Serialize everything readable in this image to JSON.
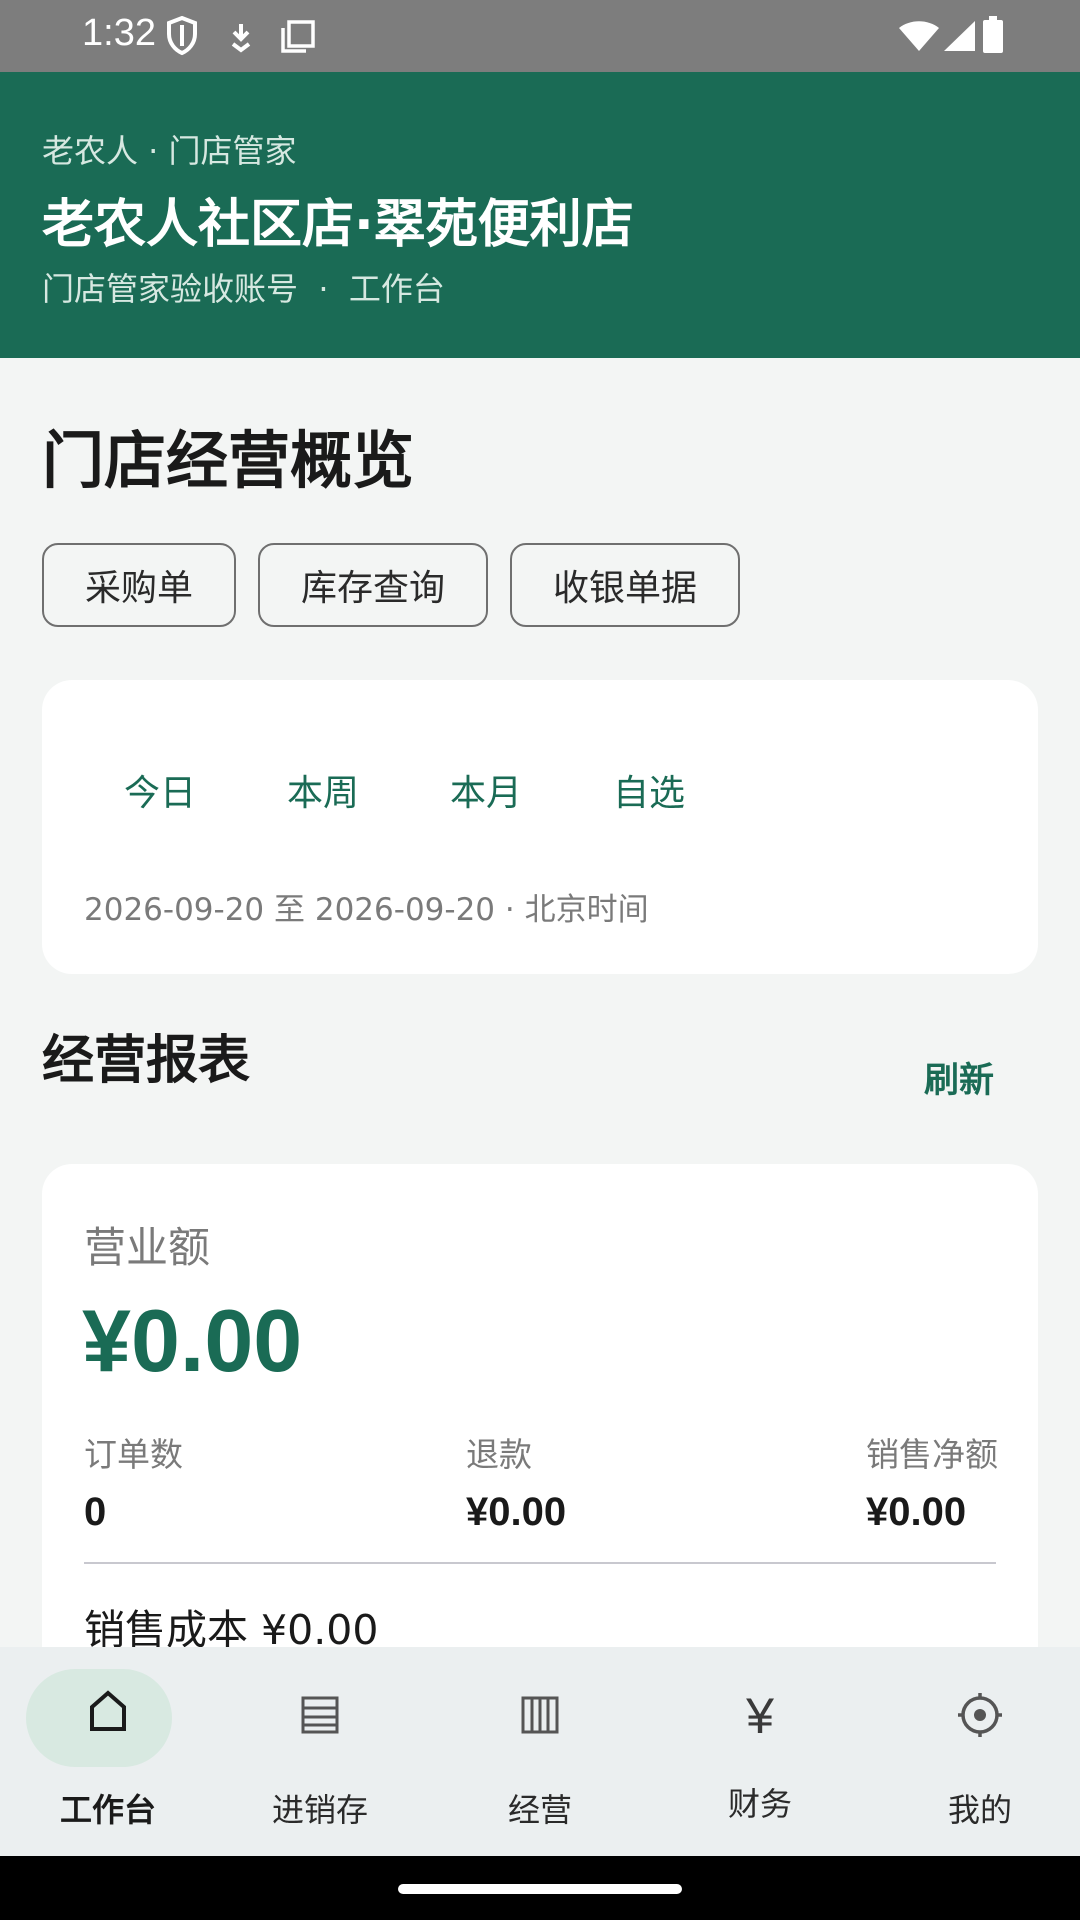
{
  "status_bar": {
    "time": "1:32",
    "left_icons": [
      "shield-icon",
      "download-icon",
      "copy-icon"
    ],
    "right_icons": [
      "wifi-icon",
      "signal-icon",
      "battery-icon"
    ]
  },
  "header": {
    "brand": "老农人 · 门店管家",
    "store_name": "老农人社区店·翠苑便利店",
    "subtitle": "门店管家验收账号  ·  工作台",
    "bg_color": "#1a6b55"
  },
  "page_title": "门店经营概览",
  "quick_actions": [
    "采购单",
    "库存查询",
    "收银单据"
  ],
  "period": {
    "tabs": [
      "今日",
      "本周",
      "本月",
      "自选"
    ],
    "range_text": "2026-09-20 至 2026-09-20 · 北京时间"
  },
  "report": {
    "section_title": "经营报表",
    "refresh_label": "刷新",
    "revenue_label": "营业额",
    "revenue_value": "¥0.00",
    "stats": [
      {
        "label": "订单数",
        "value": "0"
      },
      {
        "label": "退款",
        "value": "¥0.00"
      },
      {
        "label": "销售净额",
        "value": "¥0.00"
      }
    ],
    "cost_line": "销售成本 ¥0.00"
  },
  "bottom_nav": {
    "items": [
      {
        "label": "工作台",
        "icon": "home-icon",
        "active": true
      },
      {
        "label": "进销存",
        "icon": "list-icon",
        "active": false
      },
      {
        "label": "经营",
        "icon": "columns-icon",
        "active": false
      },
      {
        "label": "财务",
        "icon": "yen-icon",
        "active": false
      },
      {
        "label": "我的",
        "icon": "gear-icon",
        "active": false
      }
    ]
  },
  "colors": {
    "accent": "#1a6b55",
    "active_pill": "#d8e9e1"
  }
}
